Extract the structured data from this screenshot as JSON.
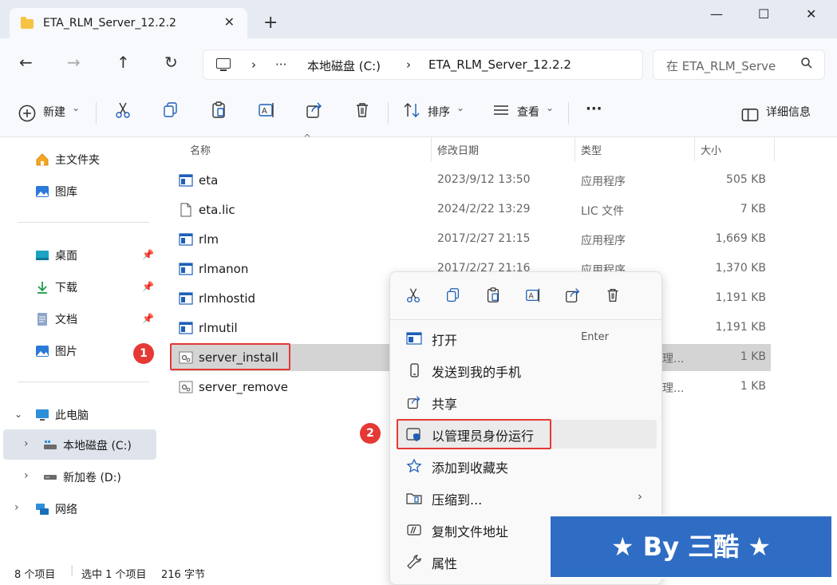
{
  "tab": {
    "title": "ETA_RLM_Server_12.2.2",
    "close": "✕",
    "new": "+"
  },
  "window": {
    "minimize": "—",
    "maximize": "☐",
    "close": "✕"
  },
  "nav": {
    "back": "←",
    "forward": "→",
    "up": "↑",
    "refresh": "↻",
    "breadcrumb": {
      "sep": "›",
      "more": "···",
      "drive": "本地磁盘 (C:)",
      "folder": "ETA_RLM_Server_12.2.2"
    },
    "search_placeholder": "在 ETA_RLM_Serve"
  },
  "toolbar": {
    "new": "新建",
    "sort": "排序",
    "view": "查看",
    "more": "···",
    "details": "详细信息",
    "caret": "⌄"
  },
  "sidebar": {
    "home": "主文件夹",
    "gallery": "图库",
    "desktop": "桌面",
    "downloads": "下载",
    "documents": "文档",
    "pictures": "图片",
    "thispc": "此电脑",
    "c_drive": "本地磁盘 (C:)",
    "d_drive": "新加卷 (D:)",
    "network": "网络"
  },
  "columns": {
    "name": "名称",
    "date": "修改日期",
    "type": "类型",
    "size": "大小"
  },
  "files": [
    {
      "name": "eta",
      "date": "2023/9/12 13:50",
      "type": "应用程序",
      "size": "505 KB"
    },
    {
      "name": "eta.lic",
      "date": "2024/2/22 13:29",
      "type": "LIC 文件",
      "size": "7 KB"
    },
    {
      "name": "rlm",
      "date": "2017/2/27 21:15",
      "type": "应用程序",
      "size": "1,669 KB"
    },
    {
      "name": "rlmanon",
      "date": "2017/2/27 21:16",
      "type": "应用程序",
      "size": "1,370 KB"
    },
    {
      "name": "rlmhostid",
      "date": "",
      "type": "",
      "size": "1,191 KB"
    },
    {
      "name": "rlmutil",
      "date": "",
      "type": "",
      "size": "1,191 KB"
    },
    {
      "name": "server_install",
      "date": "",
      "type": "理...",
      "size": "1 KB"
    },
    {
      "name": "server_remove",
      "date": "",
      "type": "理...",
      "size": "1 KB"
    }
  ],
  "context_menu": {
    "open": "打开",
    "open_shortcut": "Enter",
    "send_phone": "发送到我的手机",
    "share": "共享",
    "run_admin": "以管理员身份运行",
    "add_fav": "添加到收藏夹",
    "compress": "压缩到...",
    "copy_path": "复制文件地址",
    "properties": "属性",
    "submenu_arrow": "›"
  },
  "status": {
    "count": "8 个项目",
    "selected": "选中 1 个项目",
    "size": "216 字节"
  },
  "badges": {
    "one": "1",
    "two": "2"
  },
  "watermark": "★ By 三酷 ★"
}
